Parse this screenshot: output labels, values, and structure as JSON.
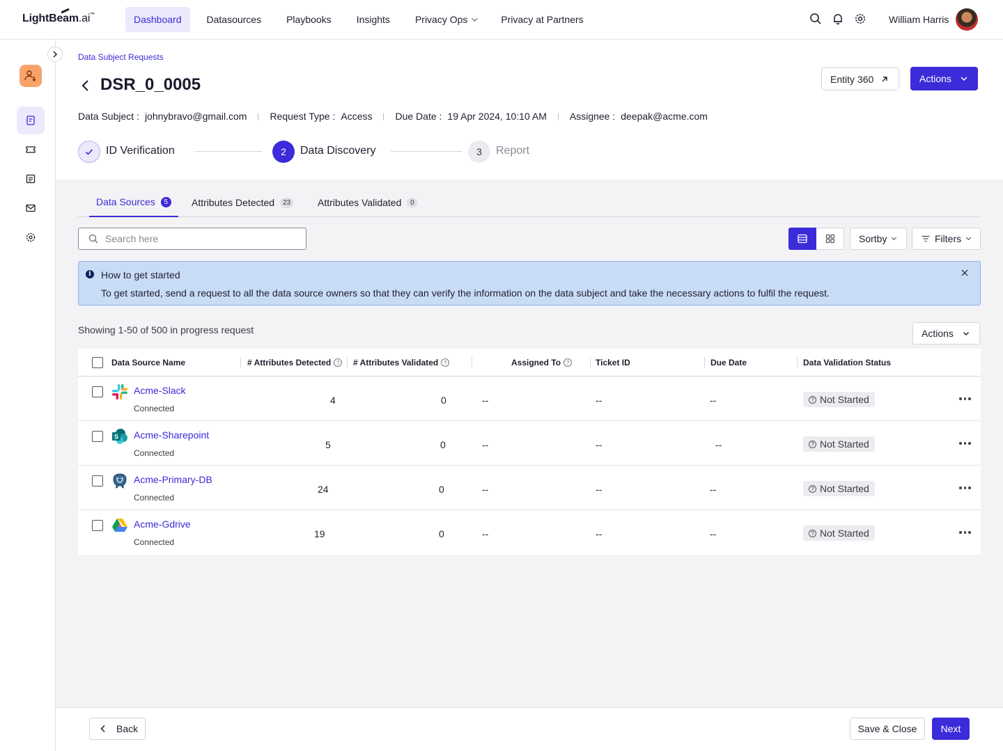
{
  "brand": {
    "name_bold": "LightBeam",
    "name_suffix": ".ai",
    "tm": "™"
  },
  "nav": {
    "items": [
      {
        "label": "Dashboard",
        "active": true
      },
      {
        "label": "Datasources"
      },
      {
        "label": "Playbooks"
      },
      {
        "label": "Insights"
      },
      {
        "label": "Privacy Ops",
        "dropdown": true
      },
      {
        "label": "Privacy at Partners"
      }
    ]
  },
  "user": {
    "name": "William Harris"
  },
  "breadcrumb": "Data Subject Requests",
  "page": {
    "title": "DSR_0_0005"
  },
  "header_buttons": {
    "entity": "Entity 360",
    "actions": "Actions"
  },
  "meta": {
    "subject_label": "Data Subject :",
    "subject_value": "johnybravo@gmail.com",
    "type_label": "Request Type :",
    "type_value": "Access",
    "due_label": "Due Date :",
    "due_value": "19 Apr 2024, 10:10 AM",
    "assignee_label": "Assignee :",
    "assignee_value": "deepak@acme.com"
  },
  "stepper": {
    "steps": [
      {
        "number": "",
        "label": "ID Verification",
        "state": "done"
      },
      {
        "number": "2",
        "label": "Data Discovery",
        "state": "active"
      },
      {
        "number": "3",
        "label": "Report",
        "state": "pending"
      }
    ]
  },
  "tabs": [
    {
      "label": "Data Sources",
      "count": "5",
      "active": true
    },
    {
      "label": "Attributes Detected",
      "count": "23"
    },
    {
      "label": "Attributes Validated",
      "count": "0"
    }
  ],
  "search": {
    "placeholder": "Search here"
  },
  "toolbar": {
    "sort_label": "Sortby",
    "filter_label": "Filters"
  },
  "banner": {
    "title": "How to get started",
    "text": "To get started, send a request to all the data source owners so that they can verify the information on the data subject and take the necessary actions to fulfil the request."
  },
  "list": {
    "showing": "Showing 1-50 of 500 in progress request",
    "actions_label": "Actions"
  },
  "table": {
    "columns": {
      "name": "Data Source Name",
      "detected": "# Attributes Detected",
      "validated": "# Attributes Validated",
      "assigned": "Assigned To",
      "ticket": "Ticket ID",
      "due": "Due Date",
      "status": "Data Validation Status"
    },
    "rows": [
      {
        "name": "Acme-Slack",
        "conn": "Connected",
        "detected": "4",
        "validated": "0",
        "assigned": "--",
        "ticket": "--",
        "due": "--",
        "status": "Not Started",
        "icon": "slack-icon"
      },
      {
        "name": "Acme-Sharepoint",
        "conn": "Connected",
        "detected": "5",
        "validated": "0",
        "assigned": "--",
        "ticket": "--",
        "due": "--",
        "status": "Not Started",
        "icon": "sharepoint-icon"
      },
      {
        "name": "Acme-Primary-DB",
        "conn": "Connected",
        "detected": "24",
        "validated": "0",
        "assigned": "--",
        "ticket": "--",
        "due": "--",
        "status": "Not Started",
        "icon": "postgres-icon"
      },
      {
        "name": "Acme-Gdrive",
        "conn": "Connected",
        "detected": "19",
        "validated": "0",
        "assigned": "--",
        "ticket": "--",
        "due": "--",
        "status": "Not Started",
        "icon": "gdrive-icon"
      }
    ]
  },
  "footer": {
    "back": "Back",
    "save_close": "Save & Close",
    "next": "Next"
  },
  "colors": {
    "accent": "#3b2bd8",
    "banner_bg": "#c9dcf6",
    "brand_orange": "#f7a36a"
  }
}
